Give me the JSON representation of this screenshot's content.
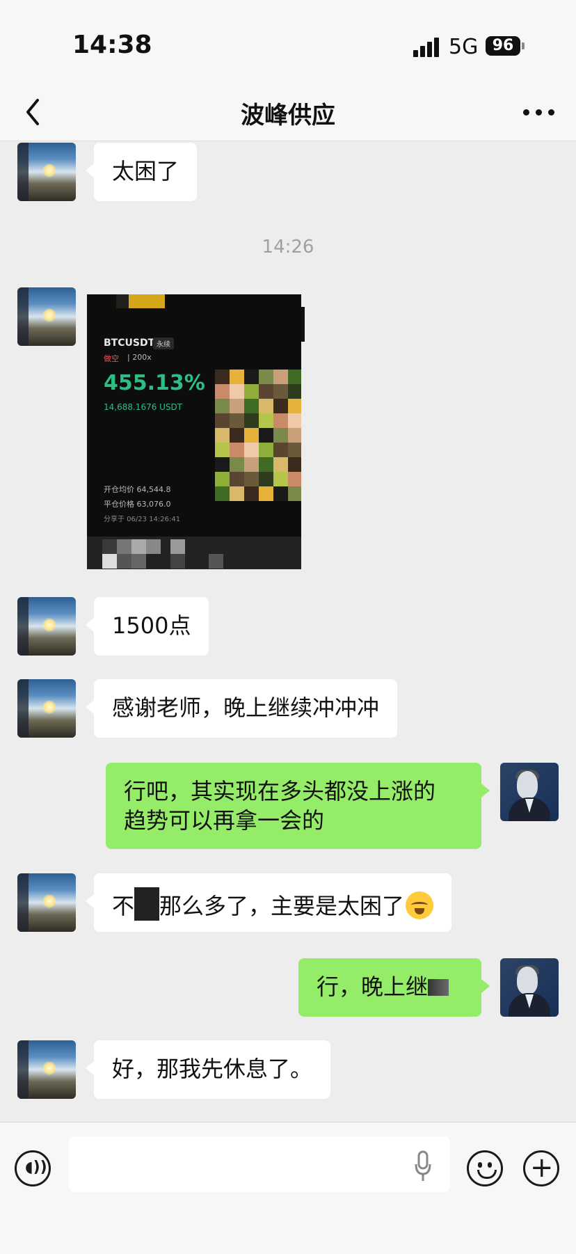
{
  "status_bar": {
    "time": "14:38",
    "network": "5G",
    "battery": "96"
  },
  "nav": {
    "title": "波峰供应"
  },
  "timestamp": "14:26",
  "messages": [
    {
      "side": "left",
      "type": "text",
      "text": "太困了"
    },
    {
      "side": "left",
      "type": "image"
    },
    {
      "side": "left",
      "type": "text",
      "text": "1500点"
    },
    {
      "side": "left",
      "type": "text",
      "text": "感谢老师，晚上继续冲冲冲"
    },
    {
      "side": "right",
      "type": "text",
      "text": "行吧，其实现在多头都没上涨的\n趋势可以再拿一会的"
    },
    {
      "side": "left",
      "type": "text",
      "text_prefix": "不",
      "text_suffix": "那么多了，主要是太困了",
      "emoji": "crying-laughing-emoji"
    },
    {
      "side": "right",
      "type": "text",
      "text": "行，晚上继"
    },
    {
      "side": "left",
      "type": "text",
      "text": "好，那我先休息了。"
    }
  ],
  "trade_image": {
    "symbol": "BTCUSDT",
    "tag": "永续",
    "direction": "做空",
    "leverage": "200x",
    "pnl_percent": "455.13%",
    "pnl_amount": "14,688.1676 USDT",
    "open_price_label": "开仓均价",
    "open_price": "64,544.8",
    "close_price_label": "平仓价格",
    "close_price": "63,076.0",
    "share_text": "分享于 06/23 14:26:41"
  },
  "colors": {
    "sent_bubble": "#95ec69",
    "received_bubble": "#ffffff",
    "background": "#ededed",
    "profit_green": "#2ebd85"
  }
}
